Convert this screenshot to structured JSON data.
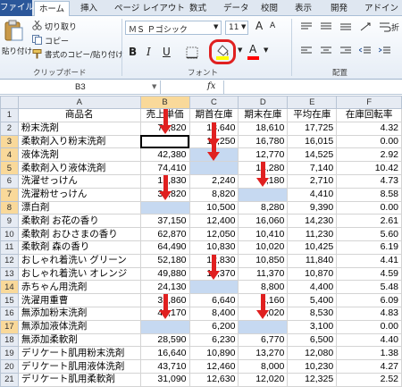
{
  "tabs": [
    "ファイル",
    "ホーム",
    "挿入",
    "ページ レイアウト",
    "数式",
    "データ",
    "校閲",
    "表示",
    "開発",
    "アドイン"
  ],
  "clipboard": {
    "paste": "貼り付け",
    "cut": "切り取り",
    "copy": "コピー",
    "format_painter": "書式のコピー/貼り付け",
    "label": "クリップボード"
  },
  "font": {
    "name": "ＭＳ Ｐゴシック",
    "size": "11",
    "label": "フォント",
    "bold": "B",
    "italic": "I",
    "underline": "U",
    "grow": "A",
    "shrink": "A",
    "fill_color": "#ffff00",
    "font_color": "#ff0000",
    "highlight_ring": "#e02020"
  },
  "alignment": {
    "label": "配置",
    "wrap": "折"
  },
  "formula_bar": {
    "name_box": "B3",
    "fx": "fx",
    "value": ""
  },
  "columns": [
    "A",
    "B",
    "C",
    "D",
    "E",
    "F"
  ],
  "header": [
    "商品名",
    "売上単価",
    "期首在庫",
    "期末在庫",
    "平均在庫",
    "在庫回転率"
  ],
  "rows": [
    [
      "粉末洗剤",
      "74,820",
      "18,640",
      "18,610",
      "17,725",
      "4.32"
    ],
    [
      "柔軟剤入り粉末洗剤",
      "",
      "15,250",
      "16,780",
      "16,015",
      "0.00"
    ],
    [
      "液体洗剤",
      "42,380",
      "",
      "12,770",
      "14,525",
      "2.92"
    ],
    [
      "柔軟剤入り液体洗剤",
      "74,410",
      "",
      "14,280",
      "7,140",
      "10.42"
    ],
    [
      "洗濯せっけん",
      "12,830",
      "2,240",
      "3,180",
      "2,710",
      "4.73"
    ],
    [
      "洗濯粉せっけん",
      "37,820",
      "8,820",
      "",
      "4,410",
      "8.58"
    ],
    [
      "漂白剤",
      "",
      "10,500",
      "8,280",
      "9,390",
      "0.00"
    ],
    [
      "柔軟剤 お花の香り",
      "37,150",
      "12,400",
      "16,060",
      "14,230",
      "2.61"
    ],
    [
      "柔軟剤 おひさまの香り",
      "62,870",
      "12,050",
      "10,410",
      "11,230",
      "5.60"
    ],
    [
      "柔軟剤 森の香り",
      "64,490",
      "10,830",
      "10,020",
      "10,425",
      "6.19"
    ],
    [
      "おしゃれ着洗い グリーン",
      "52,180",
      "12,830",
      "10,850",
      "11,840",
      "4.41"
    ],
    [
      "おしゃれ着洗い オレンジ",
      "49,880",
      "10,370",
      "11,370",
      "10,870",
      "4.59"
    ],
    [
      "赤ちゃん用洗剤",
      "24,130",
      "",
      "8,800",
      "4,400",
      "5.48"
    ],
    [
      "洗濯用重曹",
      "32,860",
      "6,640",
      "4,160",
      "5,400",
      "6.09"
    ],
    [
      "無添加粉末洗剤",
      "41,170",
      "8,400",
      "9,020",
      "8,530",
      "4.83"
    ],
    [
      "無添加液体洗剤",
      "",
      "6,200",
      "",
      "3,100",
      "0.00"
    ],
    [
      "無添加柔軟剤",
      "28,590",
      "6,230",
      "6,770",
      "6,500",
      "4.40"
    ],
    [
      "デリケート肌用粉末洗剤",
      "16,640",
      "10,890",
      "13,270",
      "12,080",
      "1.38"
    ],
    [
      "デリケート肌用液体洗剤",
      "43,710",
      "12,460",
      "8,000",
      "10,230",
      "4.27"
    ],
    [
      "デリケート肌用柔軟剤",
      "31,090",
      "12,630",
      "12,020",
      "12,325",
      "2.52"
    ]
  ],
  "highlight_color": "#c6d9f1",
  "arrow_color": "#e02020"
}
